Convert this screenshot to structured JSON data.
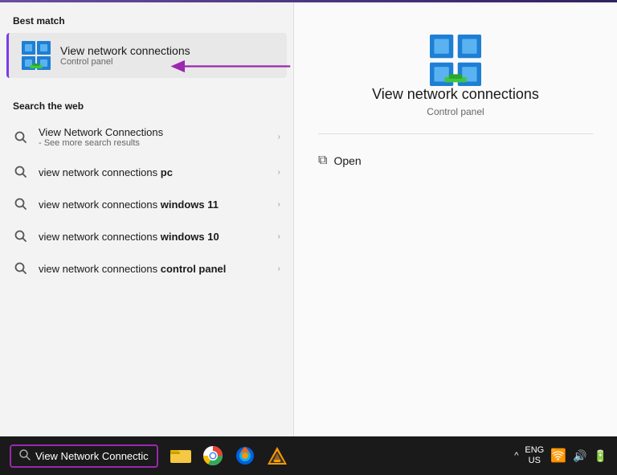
{
  "best_match": {
    "section_label": "Best match",
    "item_title": "View network connections",
    "item_subtitle": "Control panel"
  },
  "web_search": {
    "section_label": "Search the web",
    "items": [
      {
        "main": "View Network Connections",
        "sub": "- See more search results",
        "bold": false
      },
      {
        "main_plain": "view network connections ",
        "main_bold": "pc",
        "sub": "",
        "bold": true
      },
      {
        "main_plain": "view network connections ",
        "main_bold": "windows 11",
        "sub": "",
        "bold": true
      },
      {
        "main_plain": "view network connections ",
        "main_bold": "windows 10",
        "sub": "",
        "bold": true
      },
      {
        "main_plain": "view network connections ",
        "main_bold": "control panel",
        "sub": "",
        "bold": true
      }
    ]
  },
  "right_panel": {
    "title": "View network connections",
    "subtitle": "Control panel",
    "open_label": "Open"
  },
  "taskbar": {
    "search_text": "View Network Connectic",
    "lang_line1": "ENG",
    "lang_line2": "US",
    "chevron_label": "^"
  }
}
